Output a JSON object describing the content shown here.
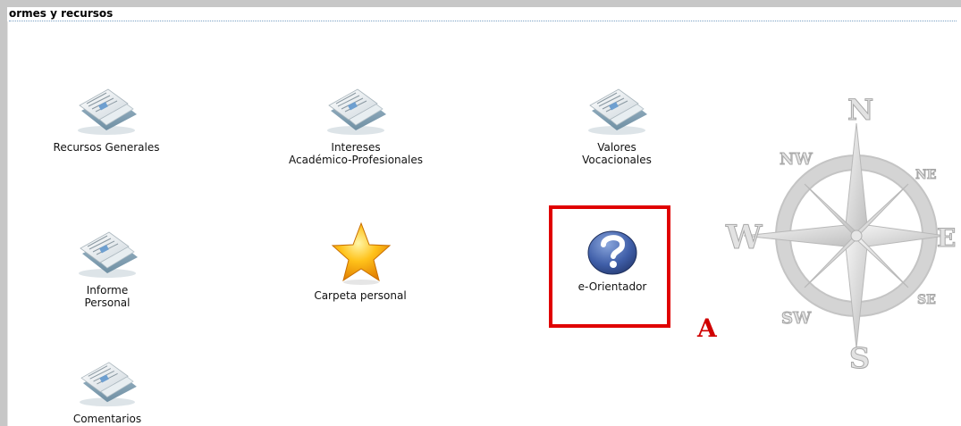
{
  "section": {
    "title": "ormes y recursos"
  },
  "tiles": {
    "recursos_generales": {
      "label": "Recursos Generales",
      "icon": "documents-icon"
    },
    "intereses": {
      "label_line1": "Intereses",
      "label_line2": "Académico-Profesionales",
      "icon": "documents-icon"
    },
    "valores": {
      "label_line1": "Valores",
      "label_line2": "Vocacionales",
      "icon": "documents-icon"
    },
    "informe_personal": {
      "label_line1": "Informe",
      "label_line2": "Personal",
      "icon": "documents-icon"
    },
    "carpeta_personal": {
      "label": "Carpeta personal",
      "icon": "star-icon"
    },
    "e_orientador": {
      "label": "e-Orientador",
      "icon": "help-icon"
    },
    "comentarios": {
      "label": "Comentarios",
      "icon": "documents-icon"
    }
  },
  "annotation": {
    "letter": "A",
    "color": "#d00000"
  },
  "compass": {
    "labels": {
      "n": "N",
      "s": "S",
      "e": "E",
      "w": "W",
      "nw": "NW",
      "ne": "NE",
      "sw": "SW",
      "se": "SE"
    }
  },
  "colors": {
    "frame": "#c7c7c7",
    "highlight": "#e00000"
  }
}
